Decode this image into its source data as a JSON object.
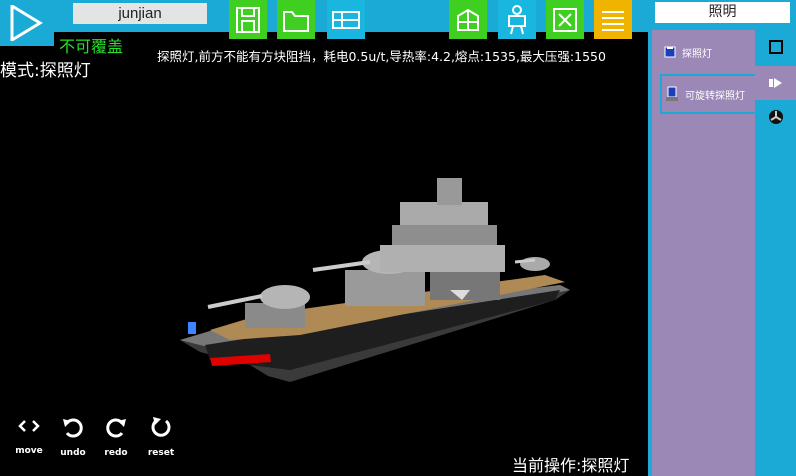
{
  "toolbar": {
    "name_value": "junjian",
    "overwrite_label": "不可覆盖",
    "buttons": [
      {
        "icon": "save-icon"
      },
      {
        "icon": "open-folder-icon"
      },
      {
        "icon": "add-part-icon"
      },
      {
        "icon": "cube-view-icon"
      },
      {
        "icon": "mech-icon"
      },
      {
        "icon": "delete-icon"
      },
      {
        "icon": "menu-icon"
      }
    ]
  },
  "mode_label": "模式:探照灯",
  "description": "探照灯,前方不能有方块阻挡，耗电0.5u/t,导热率:4.2,熔点:1535,最大压强:1550",
  "controls": [
    {
      "label": "move",
      "icon": "move-icon"
    },
    {
      "label": "undo",
      "icon": "undo-icon"
    },
    {
      "label": "redo",
      "icon": "redo-icon"
    },
    {
      "label": "reset",
      "icon": "reset-icon"
    }
  ],
  "current_op": "当前操作:探照灯",
  "right_panel": {
    "category_title": "照明",
    "items": [
      {
        "label": "探照灯",
        "selected": false
      },
      {
        "label": "可旋转探照灯",
        "selected": true
      }
    ],
    "tabs": [
      "block-tab-icon",
      "light-tab-icon",
      "fan-tab-icon"
    ]
  },
  "colors": {
    "accent": "#1ba9d6",
    "panel": "#9b88b6",
    "green": "#3fcf20",
    "yellow": "#f0b400",
    "overwrite_text": "#27e027"
  }
}
